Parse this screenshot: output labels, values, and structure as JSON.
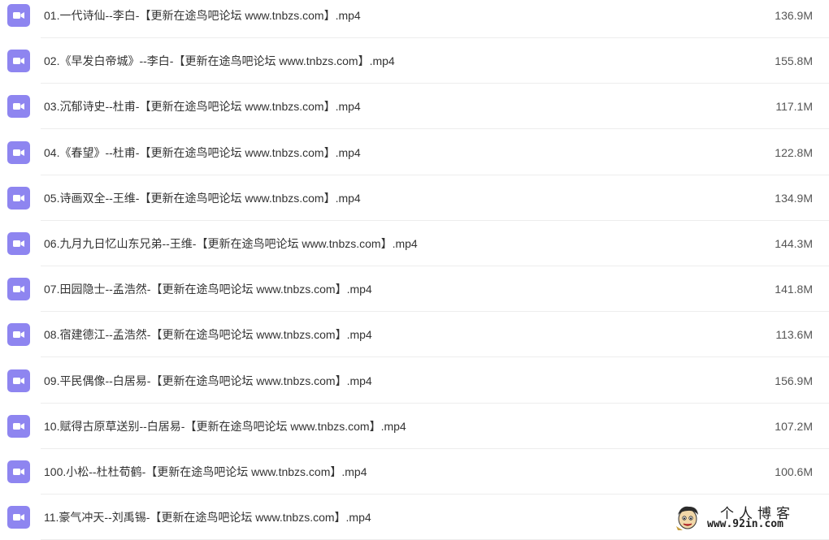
{
  "colors": {
    "video_icon": "#8e85f0",
    "divider": "#ededed",
    "text": "#333333"
  },
  "files": [
    {
      "icon": "video-file-icon",
      "name": "01.一代诗仙--李白-【更新在途鸟吧论坛 www.tnbzs.com】.mp4",
      "size": "136.9M"
    },
    {
      "icon": "video-file-icon",
      "name": "02.《早发白帝城》--李白-【更新在途鸟吧论坛 www.tnbzs.com】.mp4",
      "size": "155.8M"
    },
    {
      "icon": "video-file-icon",
      "name": "03.沉郁诗史--杜甫-【更新在途鸟吧论坛 www.tnbzs.com】.mp4",
      "size": "117.1M"
    },
    {
      "icon": "video-file-icon",
      "name": "04.《春望》--杜甫-【更新在途鸟吧论坛 www.tnbzs.com】.mp4",
      "size": "122.8M"
    },
    {
      "icon": "video-file-icon",
      "name": "05.诗画双全--王维-【更新在途鸟吧论坛 www.tnbzs.com】.mp4",
      "size": "134.9M"
    },
    {
      "icon": "video-file-icon",
      "name": "06.九月九日忆山东兄弟--王维-【更新在途鸟吧论坛 www.tnbzs.com】.mp4",
      "size": "144.3M"
    },
    {
      "icon": "video-file-icon",
      "name": "07.田园隐士--孟浩然-【更新在途鸟吧论坛 www.tnbzs.com】.mp4",
      "size": "141.8M"
    },
    {
      "icon": "video-file-icon",
      "name": "08.宿建德江--孟浩然-【更新在途鸟吧论坛 www.tnbzs.com】.mp4",
      "size": "113.6M"
    },
    {
      "icon": "video-file-icon",
      "name": "09.平民偶像--白居易-【更新在途鸟吧论坛 www.tnbzs.com】.mp4",
      "size": "156.9M"
    },
    {
      "icon": "video-file-icon",
      "name": "10.赋得古原草送别--白居易-【更新在途鸟吧论坛 www.tnbzs.com】.mp4",
      "size": "107.2M"
    },
    {
      "icon": "video-file-icon",
      "name": "100.小松--杜杜荀鹤-【更新在途鸟吧论坛 www.tnbzs.com】.mp4",
      "size": "100.6M"
    },
    {
      "icon": "video-file-icon",
      "name": "11.豪气冲天--刘禹锡-【更新在途鸟吧论坛 www.tnbzs.com】.mp4",
      "size": ""
    }
  ],
  "watermark": {
    "title": "个人博客",
    "url": "www.92in.com"
  }
}
